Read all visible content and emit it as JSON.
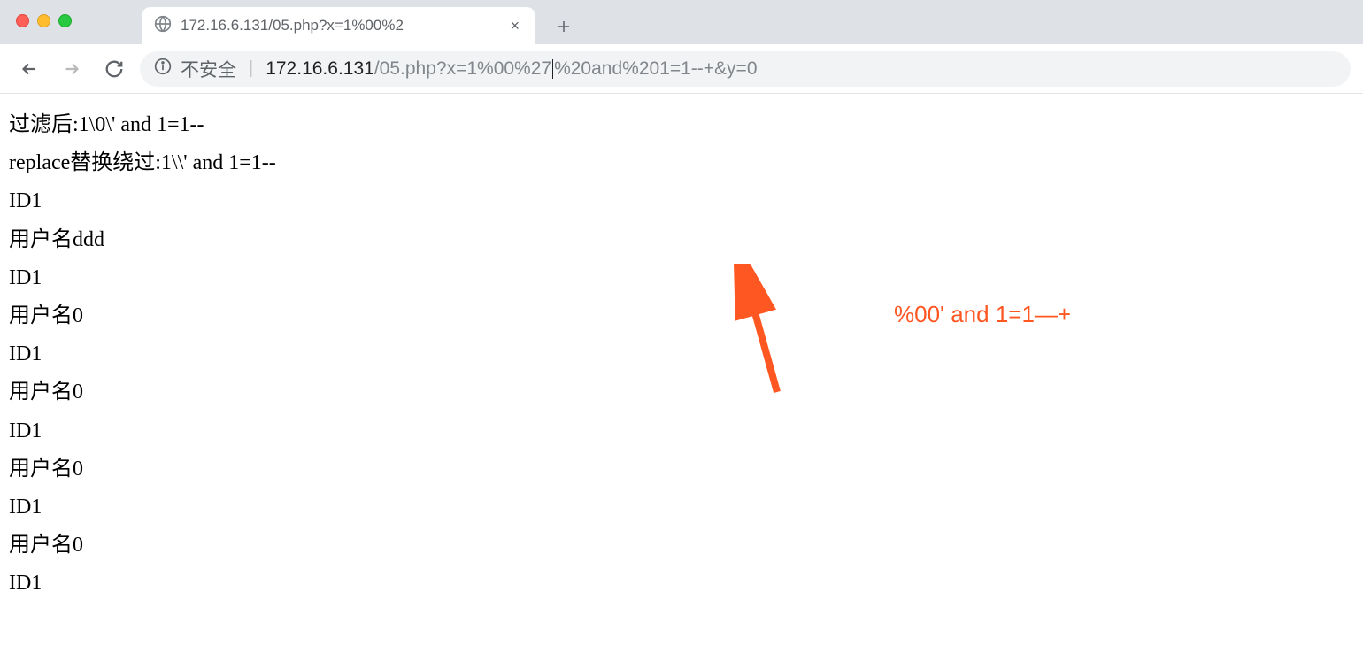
{
  "window": {
    "tab_title": "172.16.6.131/05.php?x=1%00%2",
    "new_tab_label": "+"
  },
  "toolbar": {
    "insecure_label": "不安全",
    "url_host": "172.16.6.131",
    "url_path_before_caret": "/05.php?x=1%00%27",
    "url_path_after_caret": "%20and%201=1--+&y=0"
  },
  "page": {
    "lines": [
      "过滤后:1\\0\\' and 1=1--",
      "replace替换绕过:1\\\\' and 1=1--",
      "ID1",
      "用户名ddd",
      "ID1",
      "用户名0",
      "ID1",
      "用户名0",
      "ID1",
      "用户名0",
      "ID1",
      "用户名0",
      "ID1"
    ]
  },
  "annotation": {
    "text": "%00' and 1=1—+",
    "color": "#ff5722"
  }
}
